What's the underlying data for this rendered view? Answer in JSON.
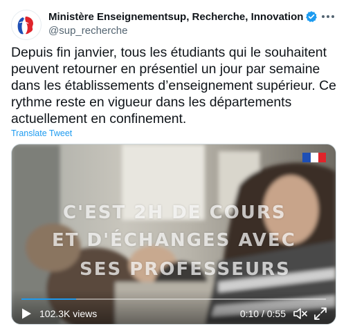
{
  "account": {
    "display_name": "Ministère Enseignementsup, Recherche, Innovation",
    "handle": "@sup_recherche",
    "avatar_icon": "marianne-logo-icon",
    "verified_icon": "verified-badge-icon",
    "verified_color": "#1d9bf0"
  },
  "tweet": {
    "text": "Depuis fin janvier, tous les étudiants qui le souhaitent peuvent retourner en présentiel un jour par semaine dans les établissements d’enseignement supérieur. Ce rythme reste en vigueur dans les départements actuellement en confinement.",
    "translate_label": "Translate Tweet"
  },
  "video": {
    "overlay_lines": [
      "C'EST 2H DE COURS",
      "ET D'ÉCHANGES AVEC",
      "SES PROFESSEURS"
    ],
    "views": "102.3K views",
    "time": "0:10 / 0:55",
    "progress": 0.18,
    "accent": "#1d9bf0"
  },
  "colors": {
    "text": "#0f1419",
    "muted": "#536471",
    "link": "#1d9bf0"
  }
}
